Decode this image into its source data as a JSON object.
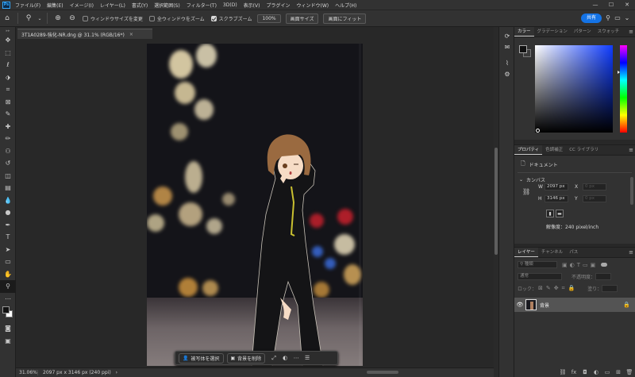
{
  "app": {
    "logo": "Ps"
  },
  "menu": [
    "ファイル(F)",
    "編集(E)",
    "イメージ(I)",
    "レイヤー(L)",
    "書式(Y)",
    "選択範囲(S)",
    "フィルター(T)",
    "3D(D)",
    "表示(V)",
    "プラグイン",
    "ウィンドウ(W)",
    "ヘルプ(H)"
  ],
  "window_controls": {
    "minimize": "—",
    "maximize": "☐",
    "close": "✕"
  },
  "options": {
    "check1": "ウィンドウサイズを変更",
    "check2": "全ウィンドウをズーム",
    "check3": "スクラブズーム",
    "btn_100": "100%",
    "btn_screen": "画面サイズ",
    "btn_fit": "画面にフィット",
    "share": "共有"
  },
  "document": {
    "tab_title": "3T1A0289-強化-NR.dng @ 31.1% (RGB/16*)",
    "tab_close": "×"
  },
  "contextbar": {
    "select_subject": "被写体を選択",
    "remove_bg": "背景を削除"
  },
  "status": {
    "zoom": "31.06%",
    "info": "2097 px x 3146 px (240 ppi)"
  },
  "color_panel": {
    "tabs": [
      "カラー",
      "グラデーション",
      "パターン",
      "スウォッチ"
    ],
    "foreground": "#111111",
    "hue_color": "#0f3cff"
  },
  "properties_panel": {
    "tabs": [
      "プロパティ",
      "色調補正",
      "CC ライブラリ"
    ],
    "doc_label": "ドキュメント",
    "section": "カンバス",
    "w_label": "W",
    "w_value": "2097 px",
    "x_label": "X",
    "x_placeholder": "0 px",
    "h_label": "H",
    "h_value": "3146 px",
    "y_label": "Y",
    "y_placeholder": "0 px",
    "resolution": "解像度：240 pixel/inch"
  },
  "layers_panel": {
    "tabs": [
      "レイヤー",
      "チャンネル",
      "パス"
    ],
    "search_placeholder": "種類",
    "blend_mode": "通常",
    "opacity_label": "不透明度：",
    "lock_label": "ロック：",
    "fill_label": "塗り：",
    "layer_name": "背景"
  }
}
